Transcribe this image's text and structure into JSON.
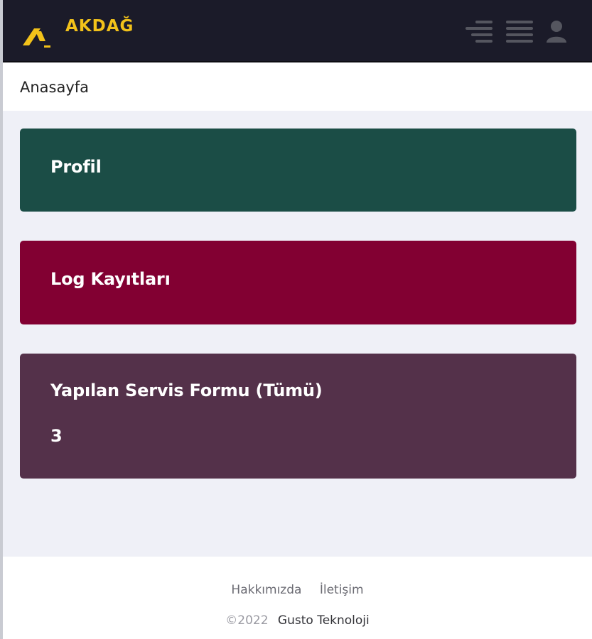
{
  "header": {
    "brand": "AKDAĞ",
    "brand_color": "#f2c21a",
    "icons": [
      "sidebar-toggle-icon",
      "menu-icon",
      "user-icon"
    ]
  },
  "breadcrumb": {
    "current": "Anasayfa"
  },
  "cards": {
    "profil": {
      "title": "Profil",
      "color": "#1b4d46"
    },
    "log": {
      "title": "Log Kayıtları",
      "color": "#820032"
    },
    "servis": {
      "title": "Yapılan Servis Formu (Tümü)",
      "count": "3",
      "color": "#54314a"
    }
  },
  "footer": {
    "links": {
      "about": "Hakkımızda",
      "contact": "İletişim"
    },
    "copyright_year": "©2022",
    "company": "Gusto Teknoloji"
  }
}
